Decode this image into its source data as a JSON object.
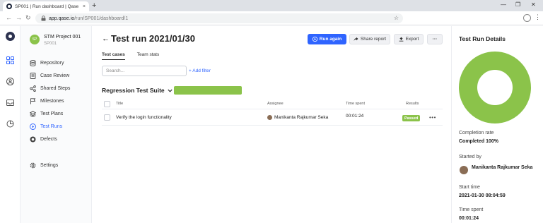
{
  "browser": {
    "tab_title": "SP001 | Run dashboard | Qase",
    "tab_close": "×",
    "new_tab": "+",
    "url_host": "app.qase.io",
    "url_path": "/run/SP001/dashboard/1",
    "window_controls": [
      "—",
      "❐",
      "✕"
    ]
  },
  "project": {
    "avatar_initials": "SP",
    "name": "STM Project 001",
    "code": "SP001"
  },
  "sidebar": {
    "items": [
      {
        "label": "Repository",
        "icon": "database-icon"
      },
      {
        "label": "Case Review",
        "icon": "review-icon"
      },
      {
        "label": "Shared Steps",
        "icon": "share-icon"
      },
      {
        "label": "Milestones",
        "icon": "milestone-icon"
      },
      {
        "label": "Test Plans",
        "icon": "layers-icon"
      },
      {
        "label": "Test Runs",
        "icon": "play-circle-icon",
        "active": true
      },
      {
        "label": "Defects",
        "icon": "bug-icon"
      },
      {
        "label": "Settings",
        "icon": "gear-icon"
      }
    ]
  },
  "header": {
    "title": "Test run 2021/01/30",
    "buttons": {
      "run_again": "Run again",
      "share_report": "Share report",
      "export": "Export",
      "more": "···"
    }
  },
  "tabs": [
    {
      "label": "Test cases",
      "active": true
    },
    {
      "label": "Team stats",
      "active": false
    }
  ],
  "search": {
    "placeholder": "Search..."
  },
  "add_filter": "+ Add filter",
  "suite": {
    "title": "Regression Test Suite",
    "progress": 1.0
  },
  "table": {
    "columns": [
      "Title",
      "Assignee",
      "Time spent",
      "Results"
    ],
    "rows": [
      {
        "title": "Verify the login functionality",
        "assignee": "Manikanta Rajkumar Seka",
        "time": "00:01:24",
        "result": "Passed"
      }
    ]
  },
  "details": {
    "title": "Test Run Details",
    "completion_rate_label": "Completion rate",
    "completion_rate_value": "Completed 100%",
    "completion_fraction": 1.0,
    "started_by_label": "Started by",
    "started_by_value": "Manikanta Rajkumar Seka",
    "start_time_label": "Start time",
    "start_time_value": "2021-01-30 08:04:59",
    "time_spent_label": "Time spent",
    "time_spent_value": "00:01:24"
  },
  "colors": {
    "accent": "#2f64ff",
    "success": "#8bc34a",
    "rail_logo": "#2d3350"
  }
}
